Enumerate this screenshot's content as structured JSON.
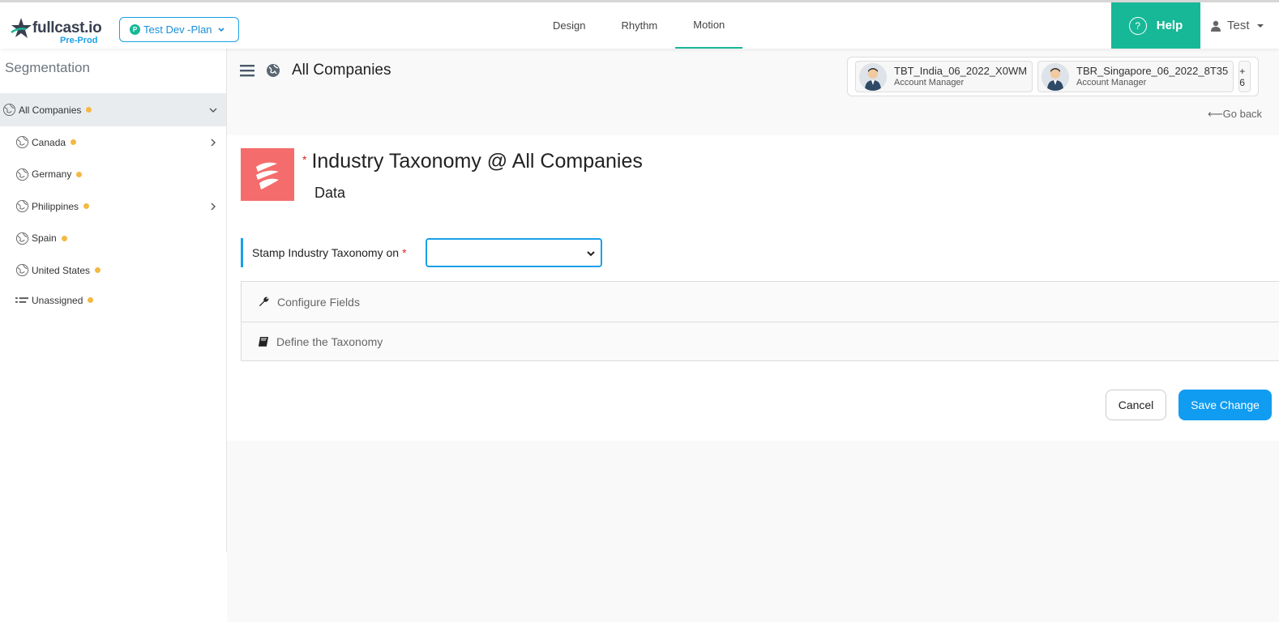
{
  "header": {
    "logo_text": "fullcast.io",
    "logo_sub": "Pre-Prod",
    "plan_badge": "P",
    "plan_label": "Test Dev -Plan",
    "tabs": [
      {
        "label": "Design"
      },
      {
        "label": "Rhythm"
      },
      {
        "label": "Motion",
        "active": true
      }
    ],
    "help_label": "Help",
    "user_name": "Test"
  },
  "sidebar": {
    "title": "Segmentation",
    "items": [
      {
        "label": "All Companies",
        "icon": "globe-icon",
        "expanded": true
      },
      {
        "label": "Canada",
        "icon": "globe-icon",
        "has_children": true
      },
      {
        "label": "Germany",
        "icon": "globe-icon"
      },
      {
        "label": "Philippines",
        "icon": "globe-icon",
        "has_children": true
      },
      {
        "label": "Spain",
        "icon": "globe-icon"
      },
      {
        "label": "United States",
        "icon": "globe-icon"
      },
      {
        "label": "Unassigned",
        "icon": "list-icon"
      }
    ],
    "status_dot_color": "#f4b942"
  },
  "main": {
    "breadcrumb_title": "All Companies",
    "assignees": [
      {
        "name": "TBT_India_06_2022_X0WM",
        "role": "Account Manager"
      },
      {
        "name": "TBR_Singapore_06_2022_8T35",
        "role": "Account Manager"
      }
    ],
    "more_assignees": "+ 6",
    "go_back": "Go back",
    "page_title": "Industry Taxonomy @ All Companies",
    "page_subtitle": "Data",
    "stamp_label": "Stamp Industry Taxonomy on",
    "stamp_value": "",
    "sections": [
      {
        "label": "Configure Fields",
        "icon": "wrench-icon"
      },
      {
        "label": "Define the Taxonomy",
        "icon": "book-icon"
      }
    ],
    "cancel_label": "Cancel",
    "save_label": "Save Change"
  },
  "colors": {
    "accent_green": "#17b897",
    "accent_blue": "#109cf1",
    "brand_tile": "#f56c6c",
    "required": "#e02424"
  }
}
